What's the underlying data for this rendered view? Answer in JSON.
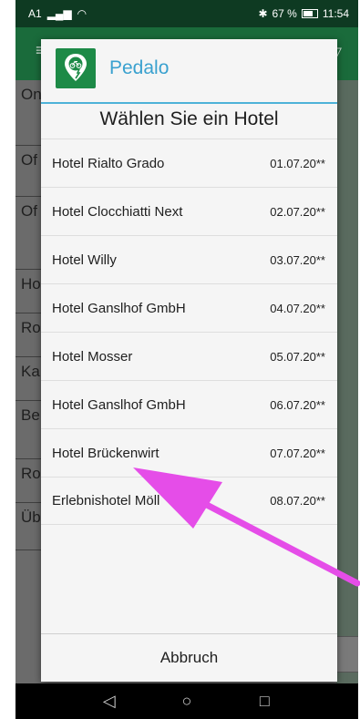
{
  "status_bar": {
    "carrier": "A1",
    "battery_percent": "67 %",
    "time": "11:54"
  },
  "dialog": {
    "brand": "Pedalo",
    "title": "Wählen Sie ein Hotel",
    "hotels": [
      {
        "name": "Hotel Rialto Grado",
        "date": "01.07.20**"
      },
      {
        "name": "Hotel Clocchiatti Next",
        "date": "02.07.20**"
      },
      {
        "name": "Hotel Willy",
        "date": "03.07.20**"
      },
      {
        "name": "Hotel Ganslhof GmbH",
        "date": "04.07.20**"
      },
      {
        "name": "Hotel Mosser",
        "date": "05.07.20**"
      },
      {
        "name": "Hotel Ganslhof GmbH",
        "date": "06.07.20**"
      },
      {
        "name": "Hotel Brückenwirt",
        "date": "07.07.20**"
      },
      {
        "name": "Erlebnishotel Möll",
        "date": "08.07.20**"
      }
    ],
    "cancel_label": "Abbruch"
  },
  "background_list": [
    "On",
    "Of",
    "Of",
    "Ho",
    "Ro",
    "Ka",
    "Be",
    "Ro",
    "Üb"
  ],
  "colors": {
    "appbar": "#1a6b3b",
    "accent": "#4db2d8",
    "brand_text": "#3aa1cf",
    "annotation_arrow": "#e54de8"
  }
}
